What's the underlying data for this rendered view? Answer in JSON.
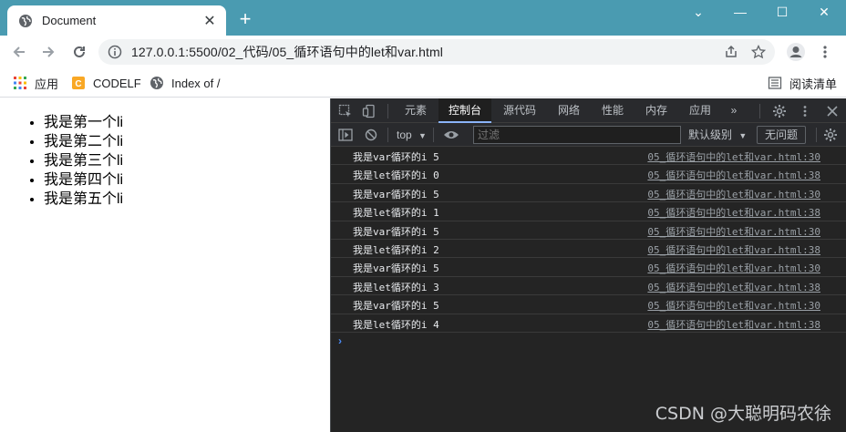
{
  "browser": {
    "tab_title": "Document",
    "new_tab_symbol": "+",
    "window_controls": {
      "minimize": "—",
      "maximize": "☐",
      "close": "✕"
    },
    "chevron": "⌄",
    "address": "127.0.0.1:5500/02_代码/05_循环语句中的let和var.html"
  },
  "bookmarks": [
    {
      "label": "应用",
      "icon": "apps-grid-icon"
    },
    {
      "label": "CODELF",
      "icon": "codelf-icon"
    },
    {
      "label": "Index of /",
      "icon": "globe-icon"
    }
  ],
  "reading_list": "阅读清单",
  "page": {
    "items": [
      "我是第一个li",
      "我是第二个li",
      "我是第三个li",
      "我是第四个li",
      "我是第五个li"
    ]
  },
  "devtools": {
    "tabs": [
      "元素",
      "控制台",
      "源代码",
      "网络",
      "性能",
      "内存",
      "应用"
    ],
    "active_tab": "控制台",
    "more_tabs": "»",
    "context": "top",
    "filter_placeholder": "过滤",
    "levels": "默认级别",
    "issues": "无问题",
    "logs": [
      {
        "msg": "我是var循环的i 5",
        "src": "05_循环语句中的let和var.html:30"
      },
      {
        "msg": "我是let循环的i 0",
        "src": "05_循环语句中的let和var.html:38"
      },
      {
        "msg": "我是var循环的i 5",
        "src": "05_循环语句中的let和var.html:30"
      },
      {
        "msg": "我是let循环的i 1",
        "src": "05_循环语句中的let和var.html:38"
      },
      {
        "msg": "我是var循环的i 5",
        "src": "05_循环语句中的let和var.html:30"
      },
      {
        "msg": "我是let循环的i 2",
        "src": "05_循环语句中的let和var.html:38"
      },
      {
        "msg": "我是var循环的i 5",
        "src": "05_循环语句中的let和var.html:30"
      },
      {
        "msg": "我是let循环的i 3",
        "src": "05_循环语句中的let和var.html:38"
      },
      {
        "msg": "我是var循环的i 5",
        "src": "05_循环语句中的let和var.html:30"
      },
      {
        "msg": "我是let循环的i 4",
        "src": "05_循环语句中的let和var.html:38"
      }
    ],
    "prompt": "›"
  },
  "watermark": "CSDN @大聪明码农徐",
  "colors": {
    "titlebar": "#4a9bb1",
    "devtools_bg": "#242424",
    "accent": "#8ab4f8"
  }
}
